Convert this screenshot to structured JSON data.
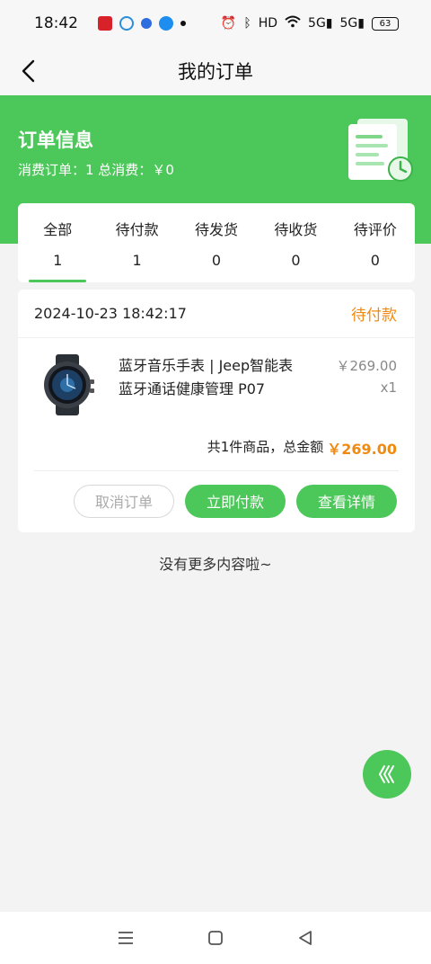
{
  "status_bar": {
    "time": "18:42",
    "network_label": "5G",
    "network_label_2": "5G",
    "hd_label": "HD",
    "battery": "63"
  },
  "header": {
    "title": "我的订单"
  },
  "banner": {
    "title": "订单信息",
    "summary": "消费订单：1 总消费：￥0"
  },
  "tabs": [
    {
      "label": "全部",
      "count": "1",
      "active": true
    },
    {
      "label": "待付款",
      "count": "1"
    },
    {
      "label": "待发货",
      "count": "0"
    },
    {
      "label": "待收货",
      "count": "0"
    },
    {
      "label": "待评价",
      "count": "0"
    }
  ],
  "order": {
    "time": "2024-10-23 18:42:17",
    "status": "待付款",
    "product_name": "蓝牙音乐手表 | Jeep智能表蓝牙通话健康管理 P07",
    "price": "￥269.00",
    "qty": "x1",
    "total_prefix": "共1件商品，总金额",
    "total_amount": "￥269.00",
    "buttons": {
      "cancel": "取消订单",
      "pay": "立即付款",
      "detail": "查看详情"
    }
  },
  "footer_text": "没有更多内容啦~",
  "colors": {
    "accent": "#4cc759",
    "status_orange": "#f08a12"
  }
}
